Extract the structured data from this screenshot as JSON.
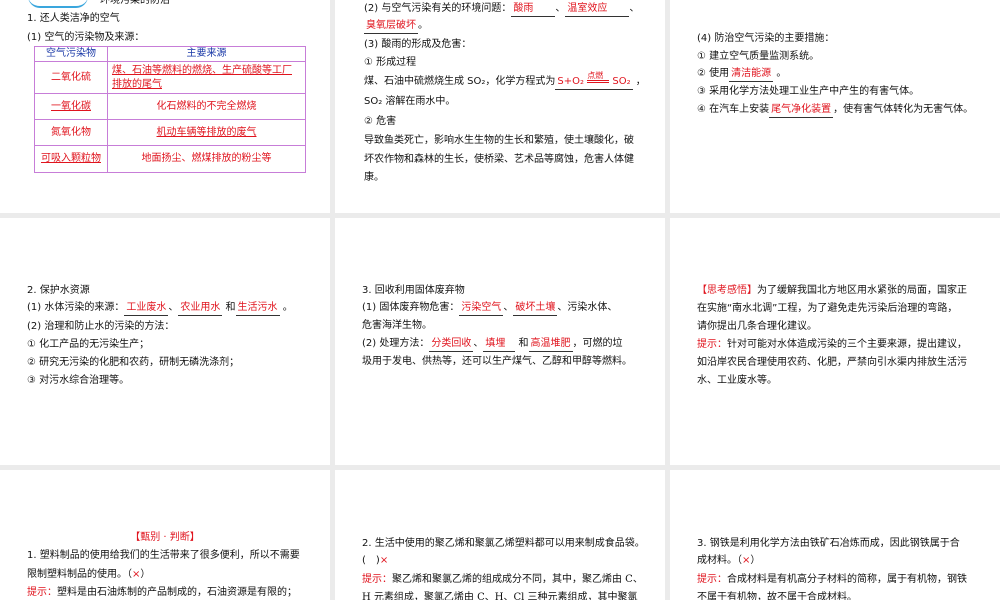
{
  "p1": {
    "header": "环境污染的防治",
    "h1": "1. 还人类洁净的空气",
    "h2": "(1) 空气的污染物及来源：",
    "table": {
      "headers": [
        "空气污染物",
        "主要来源"
      ],
      "rows": [
        [
          "二氧化硫",
          "煤、石油等燃料的燃烧、生产硫酸等工厂",
          "排放的尾气"
        ],
        [
          "一氧化碳",
          "化石燃料的不完全燃烧",
          ""
        ],
        [
          "氮氧化物",
          "机动车辆等排放的废气",
          ""
        ],
        [
          "可吸入颗粒物",
          "地面扬尘、燃煤排放的粉尘等",
          ""
        ]
      ]
    }
  },
  "p2": {
    "l1_pre": "(2) 与空气污染有关的环境问题：",
    "a1": "酸雨",
    "a2": "温室效应",
    "a3": "臭氧层破坏",
    "l3": "(3) 酸雨的形成及危害：",
    "l4": "① 形成过程",
    "l5_pre": "煤、石油中硫燃烧生成 SO₂，化学方程式为",
    "eq_left": "S+O₂",
    "eq_cond": "点燃",
    "eq_right": "SO₂",
    "l6": "SO₂ 溶解在雨水中。",
    "l7": "② 危害",
    "l8": "导致鱼类死亡，影响水生生物的生长和繁殖，使土壤酸化，破",
    "l9": "坏农作物和森林的生长，使桥梁、艺术品等腐蚀，危害人体健",
    "l10": "康。"
  },
  "p3": {
    "l1": "(4) 防治空气污染的主要措施：",
    "l2": "① 建立空气质量监测系统。",
    "l3_pre": "② 使用",
    "a1": "清洁能源",
    "l4": "③ 采用化学方法处理工业生产中产生的有害气体。",
    "l5_pre": "④ 在汽车上安装",
    "a2": "尾气净化装置",
    "l5_post": "，使有害气体转化为无害气体。"
  },
  "p4": {
    "l1": "2. 保护水资源",
    "l2_pre": "(1) 水体污染的来源：",
    "a1": "工业废水",
    "a2": "农业用水",
    "and": "和",
    "a3": "生活污水",
    "l3": "(2) 治理和防止水的污染的方法：",
    "l4": "① 化工产品的无污染生产；",
    "l5": "② 研究无污染的化肥和农药，研制无磷洗涤剂；",
    "l6": "③ 对污水综合治理等。"
  },
  "p5": {
    "l1": "3. 回收利用固体废弃物",
    "l2_pre": "(1) 固体废弃物危害：",
    "a1": "污染空气",
    "a2": "破坏土壤",
    "l2_post": "、污染水体、",
    "l3": "危害海洋生物。",
    "l4_pre": "(2) 处理方法：",
    "a3": "分类回收",
    "a4": "填埋",
    "and": "和",
    "a5": "高温堆肥",
    "l4_post": "，可燃的垃",
    "l5": "圾用于发电、供热等，还可以生产煤气、乙醇和甲醇等燃料。"
  },
  "p6": {
    "tag": "【思考感悟】",
    "l1": "为了缓解我国北方地区用水紧张的局面，国家正",
    "l2": "在实施“南水北调”工程，为了避免走先污染后治理的弯路，",
    "l3": "请你提出几条合理化建议。",
    "hint_label": "提示：",
    "h1": "针对可能对水体造成污染的三个主要来源，提出建议，",
    "h2": "如沿岸农民合理使用农药、化肥，严禁向引水渠内排放生活污",
    "h3": "水、工业废水等。"
  },
  "p7": {
    "title": "【甄别 · 判断】",
    "l1": "1. 塑料制品的使用给我们的生活带来了很多便利，所以不需要",
    "l2_pre": "限制塑料制品的使用。（",
    "mark": "×",
    "l2_post": "）",
    "hint_label": "提示：",
    "h1": "塑料是由石油炼制的产品制成的，石油资源是有限的；"
  },
  "p8": {
    "l1": "2. 生活中使用的聚乙烯和聚氯乙烯塑料都可以用来制成食品袋。",
    "l2_pre": "(　)",
    "mark": "×",
    "hint_label": "提示：",
    "h1": "聚乙烯和聚氯乙烯的组成成分不同，其中，聚乙烯由 C、",
    "h2": "H 元素组成，聚氯乙烯由 C、H、Cl 三种元素组成，其中聚氯"
  },
  "p9": {
    "l1": "3. 钢铁是利用化学方法由铁矿石冶炼而成，因此钢铁属于合",
    "l2_pre": "成材料。（",
    "mark": "×",
    "l2_post": "）",
    "hint_label": "提示：",
    "h1": "合成材料是有机高分子材料的简称，属于有机物，钢铁",
    "h2": "不属于有机物，故不属于合成材料。"
  }
}
